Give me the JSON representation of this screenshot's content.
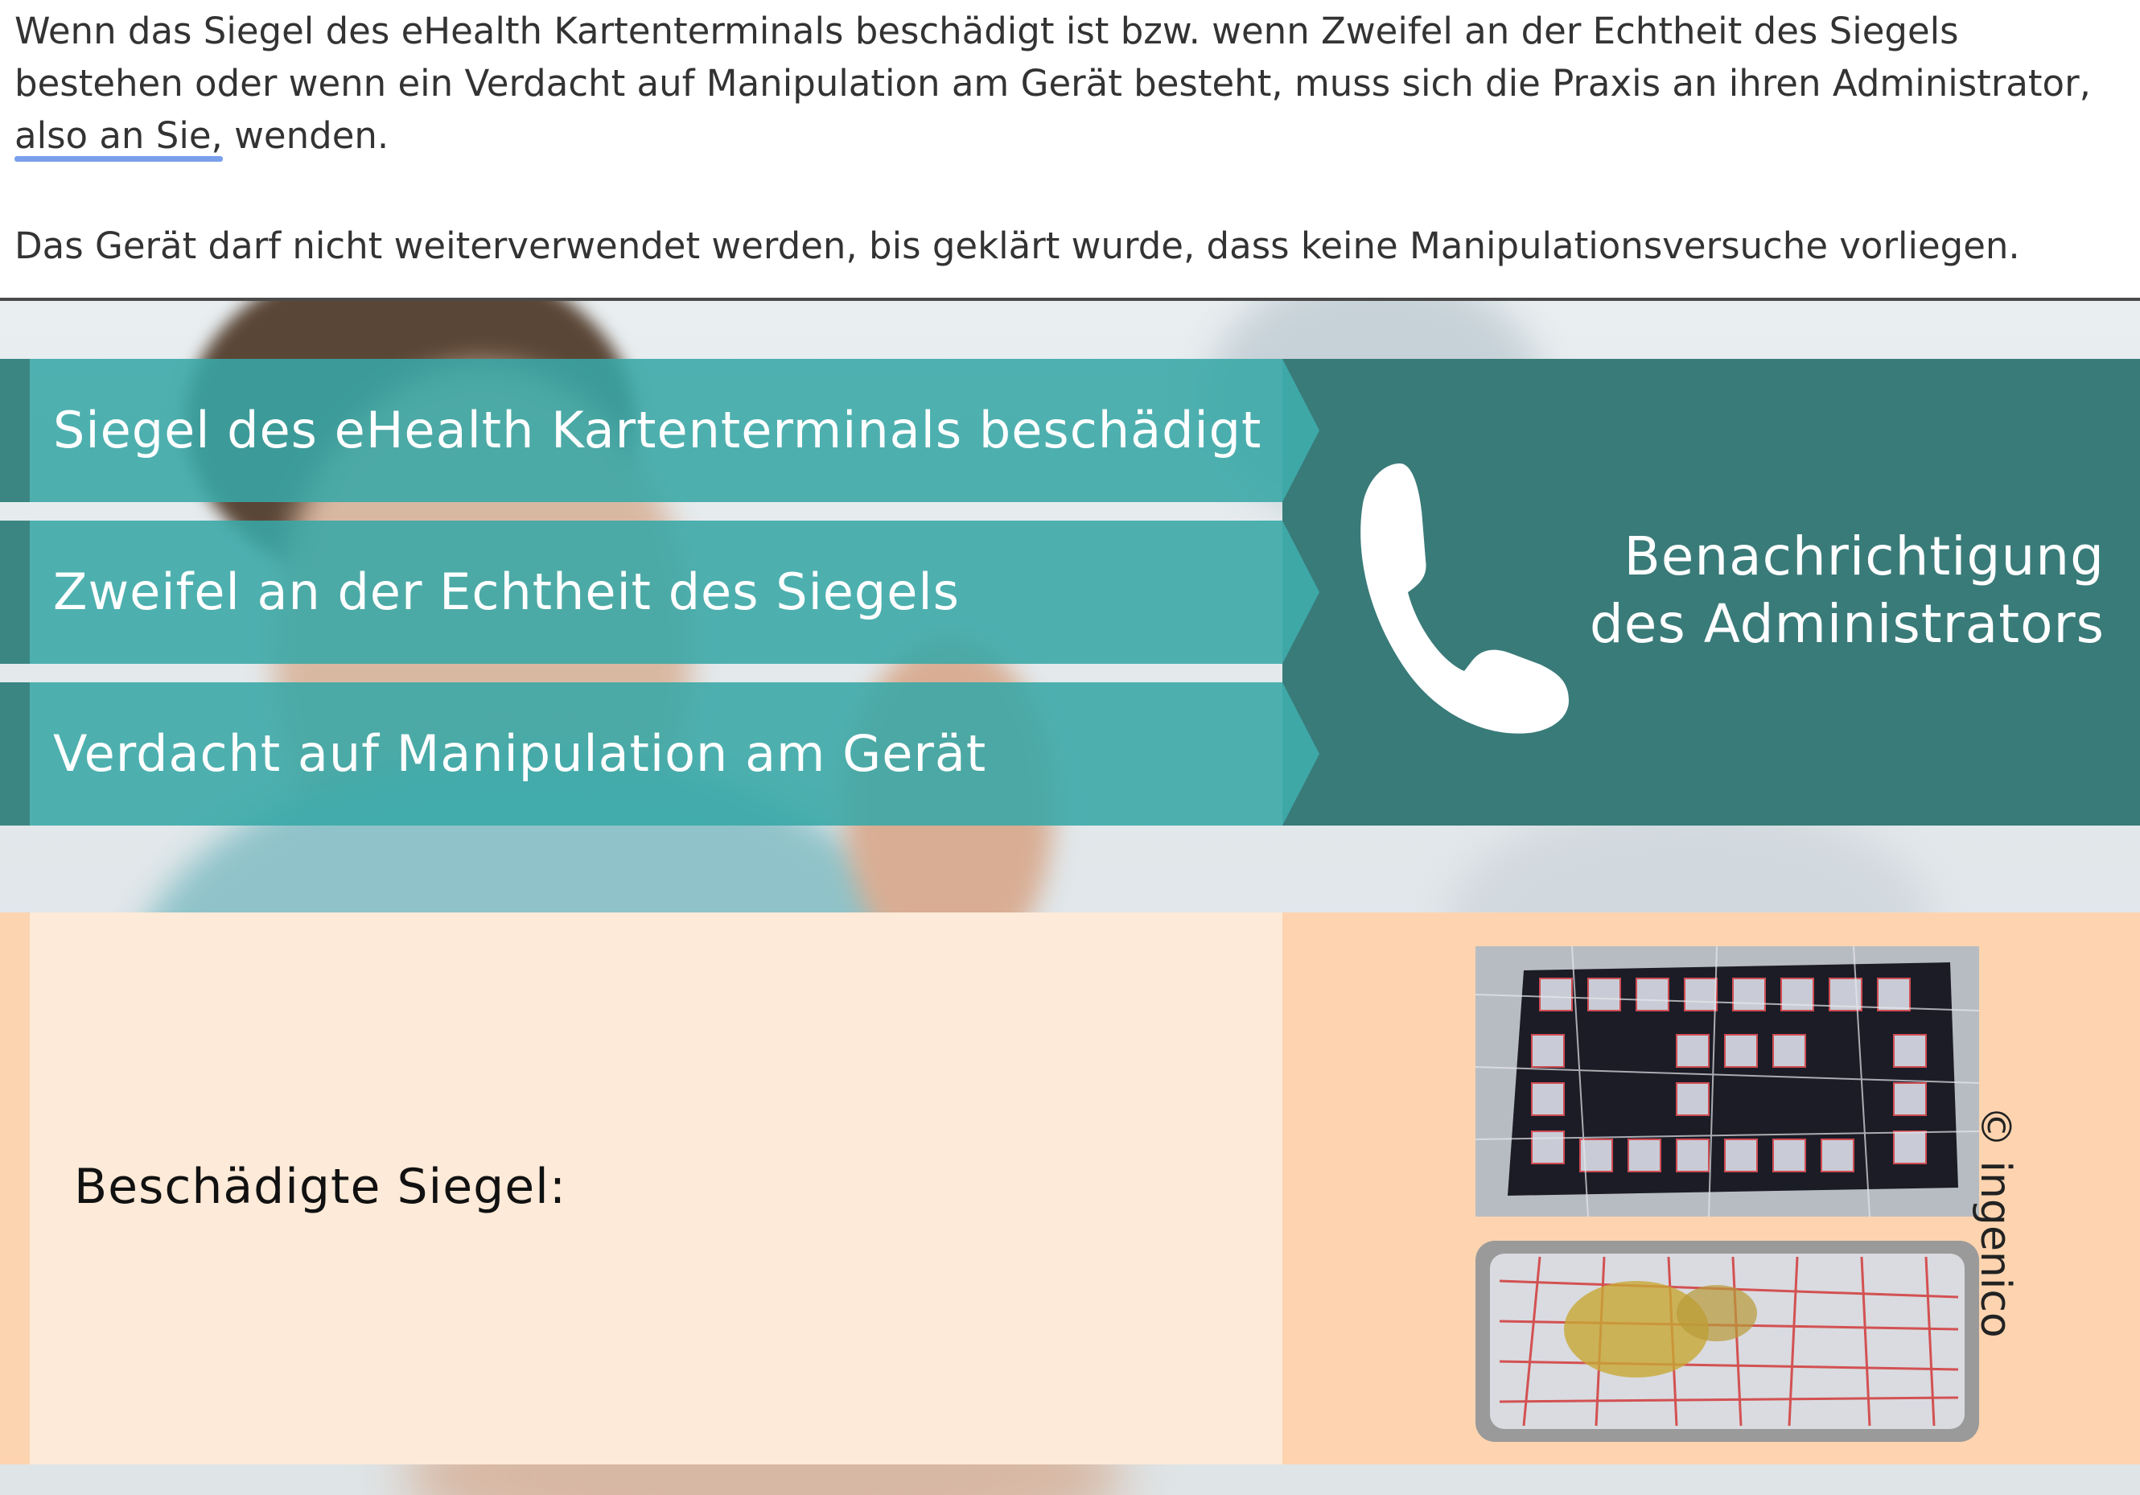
{
  "intro": {
    "paragraph1_before": "Wenn das Siegel des eHealth Kartenterminals beschädigt ist bzw. wenn Zweifel an der Echtheit des Siegels bestehen oder wenn ein Verdacht auf Manipulation am Gerät besteht, muss sich die Praxis an ihren Administrator, ",
    "paragraph1_highlight": "also an Sie,",
    "paragraph1_after": " wenden.",
    "paragraph2": "Das Gerät darf nicht weiterverwendet werden, bis geklärt wurde, dass keine Manipulationsversuche vorliegen."
  },
  "banners": [
    "Siegel des eHealth Kartenterminals beschädigt",
    "Zweifel an der Echtheit des Siegels",
    "Verdacht auf Manipulation am Gerät"
  ],
  "admin": {
    "line1": "Benachrichtigung",
    "line2": "des Administrators",
    "icon": "phone-icon"
  },
  "seals": {
    "label": "Beschädigte Siegel:",
    "copyright": "© ingenico"
  },
  "colors": {
    "banner_teal": "#38a7a6",
    "admin_teal": "#397b79",
    "seal_light": "#fdead8",
    "seal_dark": "#fdd4af",
    "highlight_underline": "#7aa0ec"
  }
}
